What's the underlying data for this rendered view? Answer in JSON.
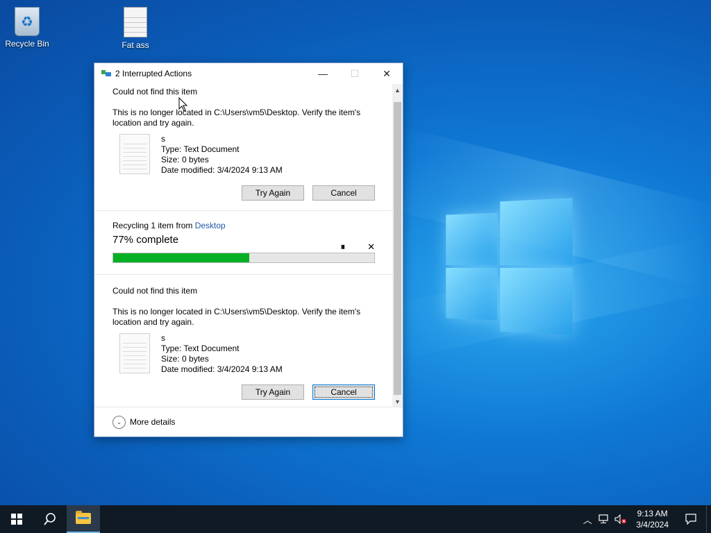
{
  "desktop": {
    "icons": [
      {
        "label": "Recycle Bin",
        "icon": "recycle-bin-icon"
      },
      {
        "label": "Fat ass",
        "icon": "text-file-icon"
      }
    ]
  },
  "dialog": {
    "title": "2 Interrupted Actions",
    "controls": {
      "minimize": "—",
      "maximize": "☐",
      "close": "✕"
    },
    "errors": [
      {
        "heading": "Could not find this item",
        "message": "This is no longer located in C:\\Users\\vm5\\Desktop. Verify the item's location and try again.",
        "file_name": "s",
        "type": "Type: Text Document",
        "size": "Size: 0 bytes",
        "modified": "Date modified: 3/4/2024 9:13 AM",
        "try_again": "Try Again",
        "cancel": "Cancel"
      },
      {
        "heading": "Could not find this item",
        "message": "This is no longer located in C:\\Users\\vm5\\Desktop. Verify the item's location and try again.",
        "file_name": "s",
        "type": "Type: Text Document",
        "size": "Size: 0 bytes",
        "modified": "Date modified: 3/4/2024 9:13 AM",
        "try_again": "Try Again",
        "cancel": "Cancel"
      }
    ],
    "progress": {
      "prefix": "Recycling 1 item from ",
      "location": "Desktop",
      "percent_text": "77% complete",
      "bar_fraction": 0.52,
      "pause": "⏸",
      "cancel": "✕",
      "fill_color": "#06b025"
    },
    "more_details": "More details"
  },
  "taskbar": {
    "time": "9:13 AM",
    "date": "3/4/2024",
    "tray_expand": "︿"
  },
  "colors": {
    "accent": "#0078d7",
    "link": "#1e5aa8",
    "taskbar": "#101a24"
  }
}
